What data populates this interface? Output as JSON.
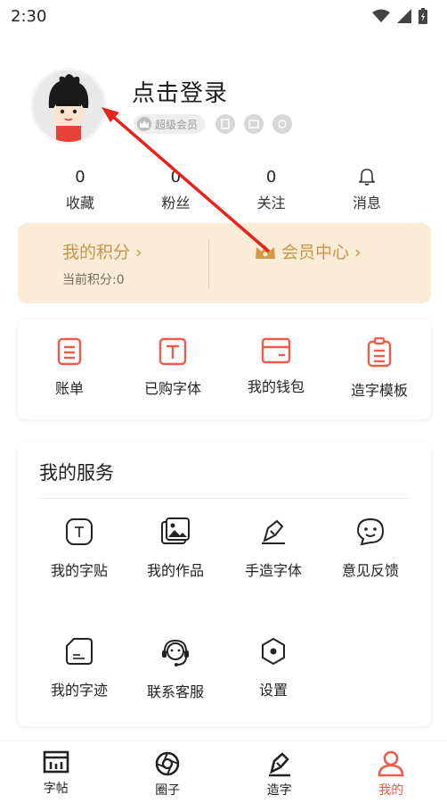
{
  "status_bar": {
    "time": "2:30"
  },
  "profile": {
    "login_text": "点击登录",
    "vip_badge": "超级会员"
  },
  "stats": [
    {
      "value": "0",
      "label": "收藏"
    },
    {
      "value": "0",
      "label": "粉丝"
    },
    {
      "value": "0",
      "label": "关注"
    },
    {
      "value": "",
      "label": "消息"
    }
  ],
  "points": {
    "title": "我的积分 ›",
    "current": "当前积分:0",
    "member_center": "会员中心 ›"
  },
  "quick_actions": [
    {
      "label": "账单",
      "icon": "bill-icon"
    },
    {
      "label": "已购字体",
      "icon": "font-purchased-icon"
    },
    {
      "label": "我的钱包",
      "icon": "wallet-icon"
    },
    {
      "label": "造字模板",
      "icon": "template-icon"
    }
  ],
  "services": {
    "title": "我的服务",
    "items": [
      {
        "label": "我的字贴",
        "icon": "copybook-icon"
      },
      {
        "label": "我的作品",
        "icon": "works-icon"
      },
      {
        "label": "手造字体",
        "icon": "handwrite-icon"
      },
      {
        "label": "意见反馈",
        "icon": "feedback-icon"
      },
      {
        "label": "我的字迹",
        "icon": "handwriting-icon"
      },
      {
        "label": "联系客服",
        "icon": "support-icon"
      },
      {
        "label": "设置",
        "icon": "settings-icon"
      }
    ]
  },
  "bottom_nav": [
    {
      "label": "字帖",
      "icon": "copybook-tab-icon"
    },
    {
      "label": "圈子",
      "icon": "circle-tab-icon"
    },
    {
      "label": "造字",
      "icon": "create-tab-icon"
    },
    {
      "label": "我的",
      "icon": "profile-tab-icon",
      "active": true
    }
  ],
  "colors": {
    "accent": "#f05a4a",
    "gold": "#c8944b",
    "points_bg": "#fbecd7"
  }
}
